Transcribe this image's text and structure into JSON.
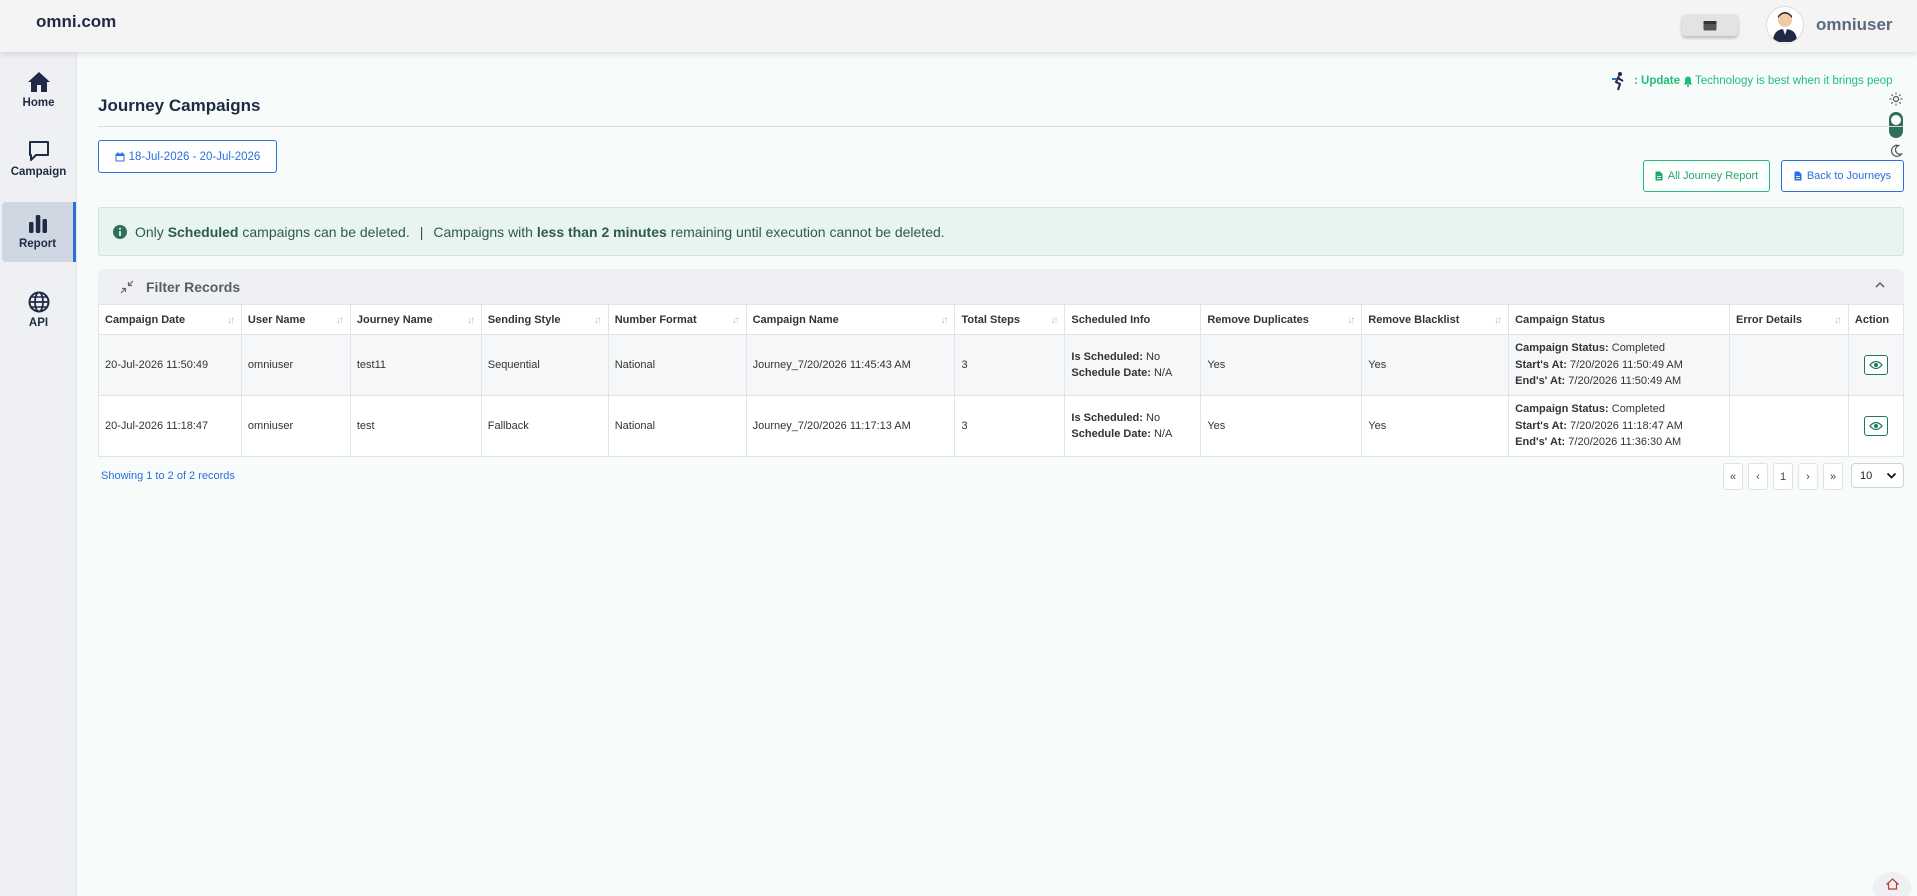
{
  "app": {
    "brand": "omni.com",
    "username": "omniuser"
  },
  "sidebar": {
    "items": [
      {
        "label": "Home",
        "icon": "home-icon"
      },
      {
        "label": "Campaign",
        "icon": "chat-icon"
      },
      {
        "label": "Report",
        "icon": "bar-chart-icon",
        "active": true
      },
      {
        "label": "API",
        "icon": "globe-icon"
      }
    ]
  },
  "header": {
    "title": "Journey Campaigns",
    "ticker_update": ": Update",
    "ticker_text": "Technology is best when it brings peop"
  },
  "date_range": "18-Jul-2026 - 20-Jul-2026",
  "buttons": {
    "all_report": "All Journey Report",
    "back": "Back to Journeys"
  },
  "alert": {
    "p1": "Only",
    "b1": "Scheduled",
    "p2": "campaigns can be deleted.",
    "sep": "|",
    "p3": "Campaigns with",
    "b2": "less than 2 minutes",
    "p4": "remaining until execution cannot be deleted."
  },
  "filter": {
    "label": "Filter Records"
  },
  "table": {
    "columns": [
      "Campaign Date",
      "User Name",
      "Journey Name",
      "Sending Style",
      "Number Format",
      "Campaign Name",
      "Total Steps",
      "Scheduled Info",
      "Remove Duplicates",
      "Remove Blacklist",
      "Campaign Status",
      "Error Details",
      "Action"
    ],
    "labels": {
      "is_scheduled": "Is Scheduled:",
      "schedule_date": "Schedule Date:",
      "campaign_status": "Campaign Status:",
      "start_at": "Start's At:",
      "end_at": "End's' At:"
    },
    "rows": [
      {
        "campaign_date": "20-Jul-2026 11:50:49",
        "user_name": "omniuser",
        "journey_name": "test11",
        "sending_style": "Sequential",
        "number_format": "National",
        "campaign_name": "Journey_7/20/2026 11:45:43 AM",
        "total_steps": "3",
        "is_scheduled": "No",
        "schedule_date": "N/A",
        "remove_duplicates": "Yes",
        "remove_blacklist": "Yes",
        "status": "Completed",
        "start_at": "7/20/2026 11:50:49 AM",
        "end_at": "7/20/2026 11:50:49 AM",
        "error_details": ""
      },
      {
        "campaign_date": "20-Jul-2026 11:18:47",
        "user_name": "omniuser",
        "journey_name": "test",
        "sending_style": "Fallback",
        "number_format": "National",
        "campaign_name": "Journey_7/20/2026 11:17:13 AM",
        "total_steps": "3",
        "is_scheduled": "No",
        "schedule_date": "N/A",
        "remove_duplicates": "Yes",
        "remove_blacklist": "Yes",
        "status": "Completed",
        "start_at": "7/20/2026 11:18:47 AM",
        "end_at": "7/20/2026 11:36:30 AM",
        "error_details": ""
      }
    ]
  },
  "footer": {
    "showing": "Showing 1 to 2 of 2 records",
    "pager": [
      "«",
      "‹",
      "1",
      "›",
      "»"
    ],
    "page_size": "10"
  },
  "colors": {
    "accent_blue": "#2a6fdb",
    "accent_green": "#1fbf7a",
    "alert_bg": "#e8f4ef"
  }
}
